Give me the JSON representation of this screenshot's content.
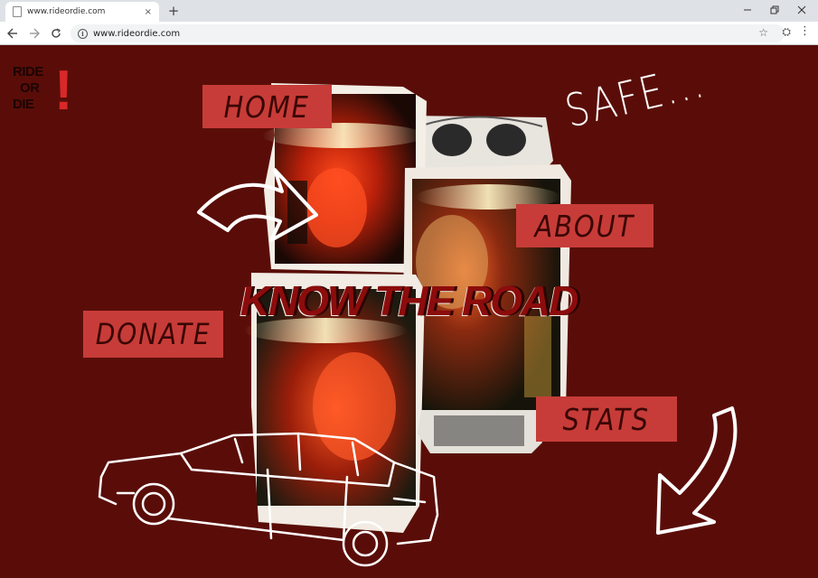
{
  "browser": {
    "tab_title": "www.rideordie.com",
    "tab_close": "×",
    "new_tab": "+",
    "url": "www.rideordie.com",
    "icons": {
      "back": "arrow-left-icon",
      "forward": "arrow-right-icon",
      "reload": "reload-icon",
      "info": "info-icon",
      "bookmark": "star-icon",
      "extension": "extension-icon",
      "menu": "kebab-menu-icon"
    }
  },
  "logo": {
    "line1": "RIDE",
    "line2": "OR",
    "line3": "DIE",
    "mark": "!"
  },
  "nav": {
    "home": "HOME",
    "about": "ABOUT",
    "donate": "DONATE",
    "stats": "STATS"
  },
  "headline": "KNOW THE ROAD",
  "tagline": "SAFE...",
  "colors": {
    "background": "#5a0d08",
    "label_bg": "#c73c38",
    "label_text": "#3a0604",
    "logo_bang": "#d8282a",
    "sketch": "#ffffff"
  }
}
